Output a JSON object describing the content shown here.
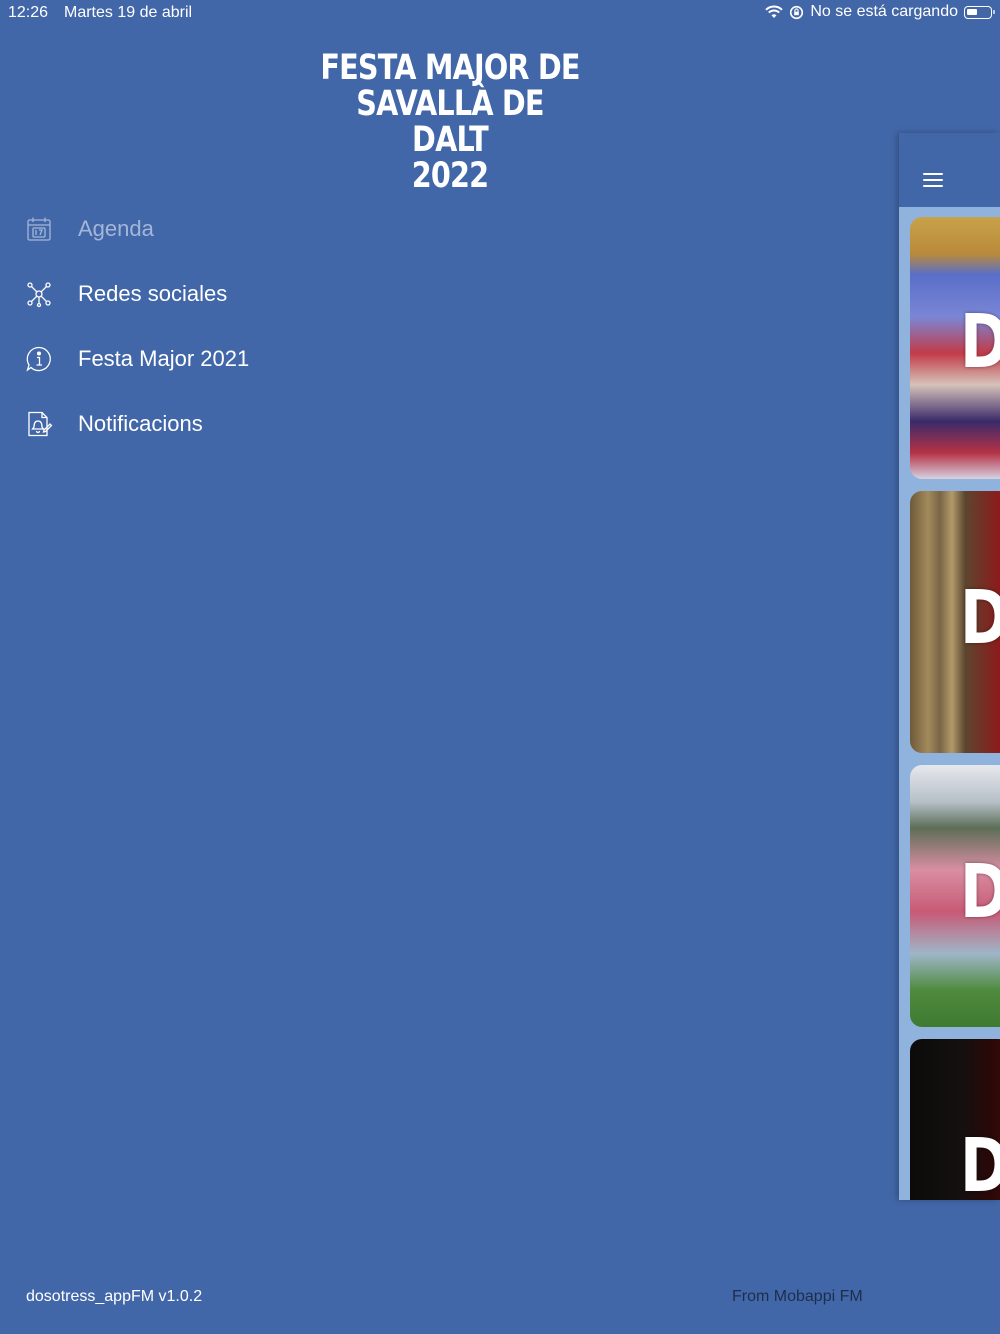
{
  "status_bar": {
    "time": "12:26",
    "date": "Martes 19 de abril",
    "charging_text": "No se está cargando",
    "icons": [
      "wifi-icon",
      "lock-rotation-icon",
      "battery-icon"
    ]
  },
  "title": {
    "line1": "FESTA MAJOR DE",
    "line2": "SAVALLÀ DE DALT",
    "line3": "2022"
  },
  "menu": {
    "items": [
      {
        "label": "Agenda",
        "icon": "calendar-icon",
        "active": true
      },
      {
        "label": "Redes sociales",
        "icon": "network-icon",
        "active": false
      },
      {
        "label": "Festa Major 2021",
        "icon": "info-bubble-icon",
        "active": false
      },
      {
        "label": "Notificacions",
        "icon": "notification-document-icon",
        "active": false
      }
    ]
  },
  "peek_panel": {
    "header_icon": "hamburger-menu-icon",
    "cards": [
      {
        "letter": "D"
      },
      {
        "letter": "D"
      },
      {
        "letter": "D"
      },
      {
        "letter": "D"
      }
    ]
  },
  "footer": {
    "version": "dosotress_appFM v1.0.2",
    "credit": "From Mobappi FM"
  },
  "colors": {
    "background": "#4267a8",
    "active_item": "#a4b6d8",
    "panel": "#8fb3dd",
    "credit_text": "#1d2e4c"
  }
}
